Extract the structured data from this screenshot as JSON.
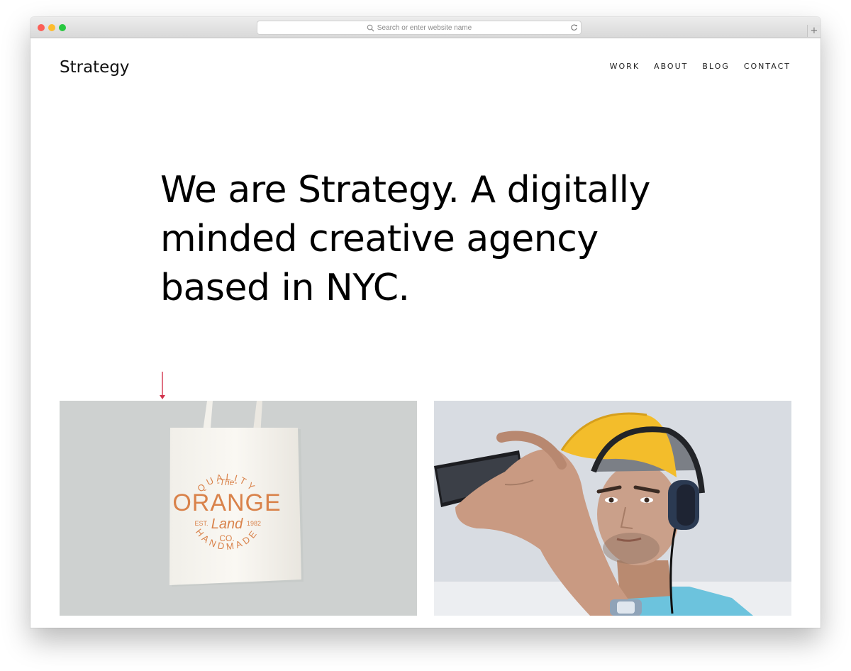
{
  "browser": {
    "url_placeholder": "Search or enter website name",
    "new_tab_label": "+"
  },
  "site": {
    "logo": "Strategy",
    "nav": [
      {
        "label": "WORK"
      },
      {
        "label": "ABOUT"
      },
      {
        "label": "BLOG"
      },
      {
        "label": "CONTACT"
      }
    ],
    "hero": {
      "line1": "We are Strategy. A digitally",
      "line2": "minded creative agency",
      "line3": "based in NYC."
    },
    "bag_print": {
      "top_arc": "QUALITY",
      "the": "-The-",
      "brand": "ORANGE",
      "est": "EST.",
      "land": "Land",
      "year": "1982",
      "co": "CO.",
      "bottom_arc": "HANDMADE"
    }
  },
  "colors": {
    "accent_arrow": "#d2334c",
    "bag_print": "#d9824a",
    "tile_black": "#000000",
    "tile_blue": "#34b4ee",
    "tile_coral": "#f47a66"
  },
  "icons": [
    "search-icon",
    "reload-icon",
    "arrow-down-icon"
  ]
}
